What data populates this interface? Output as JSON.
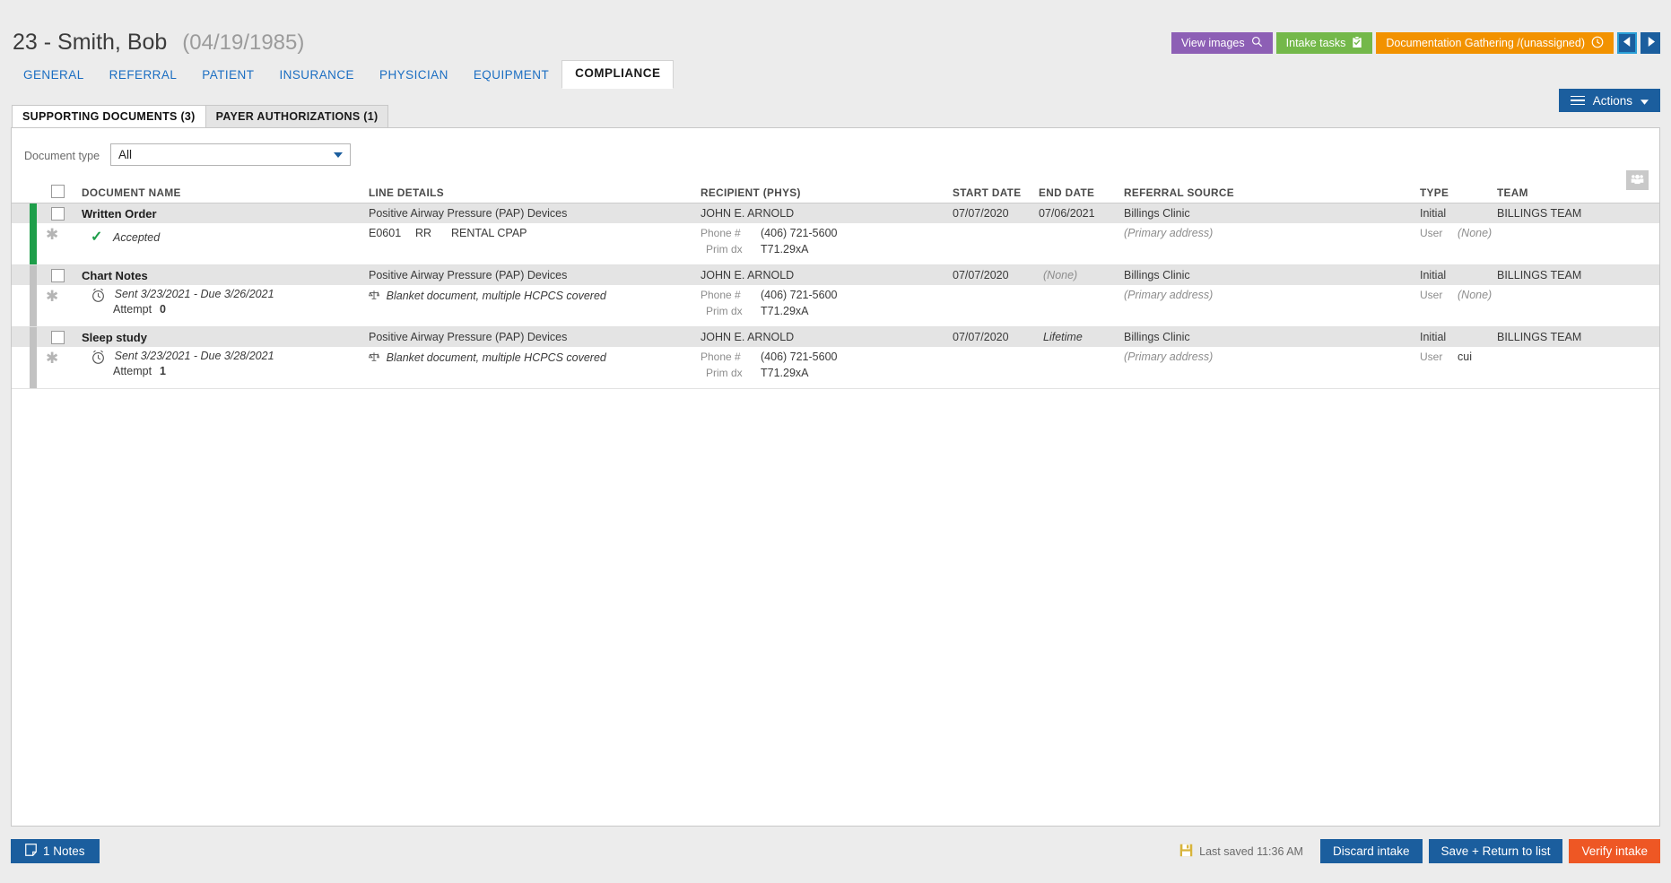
{
  "header": {
    "patient_id": "23 - Smith, Bob",
    "patient_dob": "(04/19/1985)",
    "tabs": [
      {
        "label": "GENERAL",
        "active": false
      },
      {
        "label": "REFERRAL",
        "active": false
      },
      {
        "label": "PATIENT",
        "active": false
      },
      {
        "label": "INSURANCE",
        "active": false
      },
      {
        "label": "PHYSICIAN",
        "active": false
      },
      {
        "label": "EQUIPMENT",
        "active": false
      },
      {
        "label": "COMPLIANCE",
        "active": true
      }
    ],
    "buttons": {
      "view_images": "View images",
      "intake_tasks": "Intake tasks",
      "workflow_status": "Documentation Gathering /(unassigned)"
    },
    "actions_label": "Actions"
  },
  "panel": {
    "sub_tabs": [
      {
        "label": "SUPPORTING DOCUMENTS (3)",
        "active": true
      },
      {
        "label": "PAYER AUTHORIZATIONS (1)",
        "active": false
      }
    ],
    "filter": {
      "label": "Document type",
      "value": "All"
    }
  },
  "table": {
    "columns": [
      "DOCUMENT NAME",
      "LINE DETAILS",
      "RECIPIENT (PHYS)",
      "START DATE",
      "END DATE",
      "REFERRAL SOURCE",
      "TYPE",
      "TEAM"
    ],
    "rows": [
      {
        "accent": "green",
        "name": "Written Order",
        "status_text": "Accepted",
        "status_icon": "check-icon",
        "line_details": "Positive Airway Pressure (PAP) Devices",
        "hcpcs_code": "E0601",
        "hcpcs_modifier": "RR",
        "hcpcs_desc": "RENTAL CPAP",
        "line_detail_note": "",
        "recipient": "JOHN E. ARNOLD",
        "phone_label": "Phone #",
        "phone": "(406) 721-5600",
        "dx_label": "Prim dx",
        "dx": "T71.29xA",
        "start_date": "07/07/2020",
        "end_date": "07/06/2021",
        "end_date_italic": false,
        "referral_source": "Billings Clinic",
        "referral_address": "(Primary address)",
        "type": "Initial",
        "user_label": "User",
        "user": "(None)",
        "user_italic": true,
        "team": "BILLINGS TEAM"
      },
      {
        "accent": "grey",
        "name": "Chart Notes",
        "status_text": "Sent 3/23/2021 - Due 3/26/2021",
        "status_icon": "alarm-clock-icon",
        "attempt_label": "Attempt",
        "attempt_value": "0",
        "line_details": "Positive Airway Pressure (PAP) Devices",
        "line_detail_note": "Blanket document, multiple HCPCS covered",
        "recipient": "JOHN E. ARNOLD",
        "phone_label": "Phone #",
        "phone": "(406) 721-5600",
        "dx_label": "Prim dx",
        "dx": "T71.29xA",
        "start_date": "07/07/2020",
        "end_date": "(None)",
        "end_date_italic": true,
        "referral_source": "Billings Clinic",
        "referral_address": "(Primary address)",
        "type": "Initial",
        "user_label": "User",
        "user": "(None)",
        "user_italic": true,
        "team": "BILLINGS TEAM"
      },
      {
        "accent": "grey",
        "name": "Sleep study",
        "status_text": "Sent 3/23/2021 - Due 3/28/2021",
        "status_icon": "alarm-clock-icon",
        "attempt_label": "Attempt",
        "attempt_value": "1",
        "line_details": "Positive Airway Pressure (PAP) Devices",
        "line_detail_note": "Blanket document, multiple HCPCS covered",
        "recipient": "JOHN E. ARNOLD",
        "phone_label": "Phone #",
        "phone": "(406) 721-5600",
        "dx_label": "Prim dx",
        "dx": "T71.29xA",
        "start_date": "07/07/2020",
        "end_date": "Lifetime",
        "end_date_italic": true,
        "referral_source": "Billings Clinic",
        "referral_address": "(Primary address)",
        "type": "Initial",
        "user_label": "User",
        "user": "cui",
        "user_italic": false,
        "team": "BILLINGS TEAM"
      }
    ]
  },
  "footer": {
    "notes_label": "1 Notes",
    "last_saved": "Last saved 11:36 AM",
    "discard_label": "Discard intake",
    "save_label": "Save + Return to list",
    "verify_label": "Verify intake"
  },
  "colors": {
    "accent_blue": "#1b5e9e",
    "purple": "#8d5fb5",
    "green": "#74b84a",
    "orange": "#f29200",
    "red": "#ee5724",
    "status_green": "#1e9e4a"
  }
}
